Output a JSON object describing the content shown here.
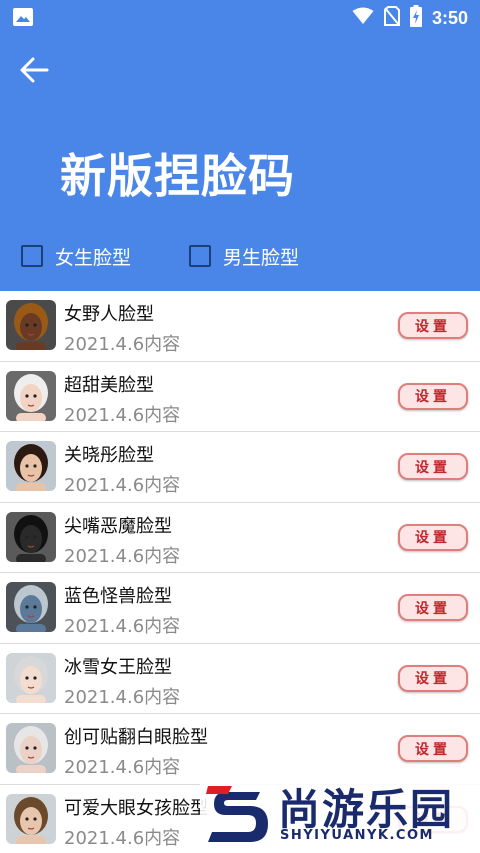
{
  "status_bar": {
    "time": "3:50",
    "icons": [
      "image-icon",
      "wifi-icon",
      "no-sim-icon",
      "battery-charging-icon"
    ]
  },
  "header": {
    "title": "新版捏脸码",
    "back_icon": "arrow-left-icon",
    "bg_color": "#4a86e8"
  },
  "filters": [
    {
      "label": "女生脸型",
      "checked": false
    },
    {
      "label": "男生脸型",
      "checked": false
    }
  ],
  "items": [
    {
      "name": "女野人脸型",
      "date": "2021.4.6内容",
      "button": "设置"
    },
    {
      "name": "超甜美脸型",
      "date": "2021.4.6内容",
      "button": "设置"
    },
    {
      "name": "关晓彤脸型",
      "date": "2021.4.6内容",
      "button": "设置"
    },
    {
      "name": "尖嘴恶魔脸型",
      "date": "2021.4.6内容",
      "button": "设置"
    },
    {
      "name": "蓝色怪兽脸型",
      "date": "2021.4.6内容",
      "button": "设置"
    },
    {
      "name": "冰雪女王脸型",
      "date": "2021.4.6内容",
      "button": "设置"
    },
    {
      "name": "创可贴翻白眼脸型",
      "date": "2021.4.6内容",
      "button": "设置"
    },
    {
      "name": "可爱大眼女孩脸型",
      "date": "2021.4.6内容",
      "button": "设置"
    }
  ],
  "watermark": {
    "name": "尚游乐园",
    "url": "SHYIYUANYK.COM"
  }
}
